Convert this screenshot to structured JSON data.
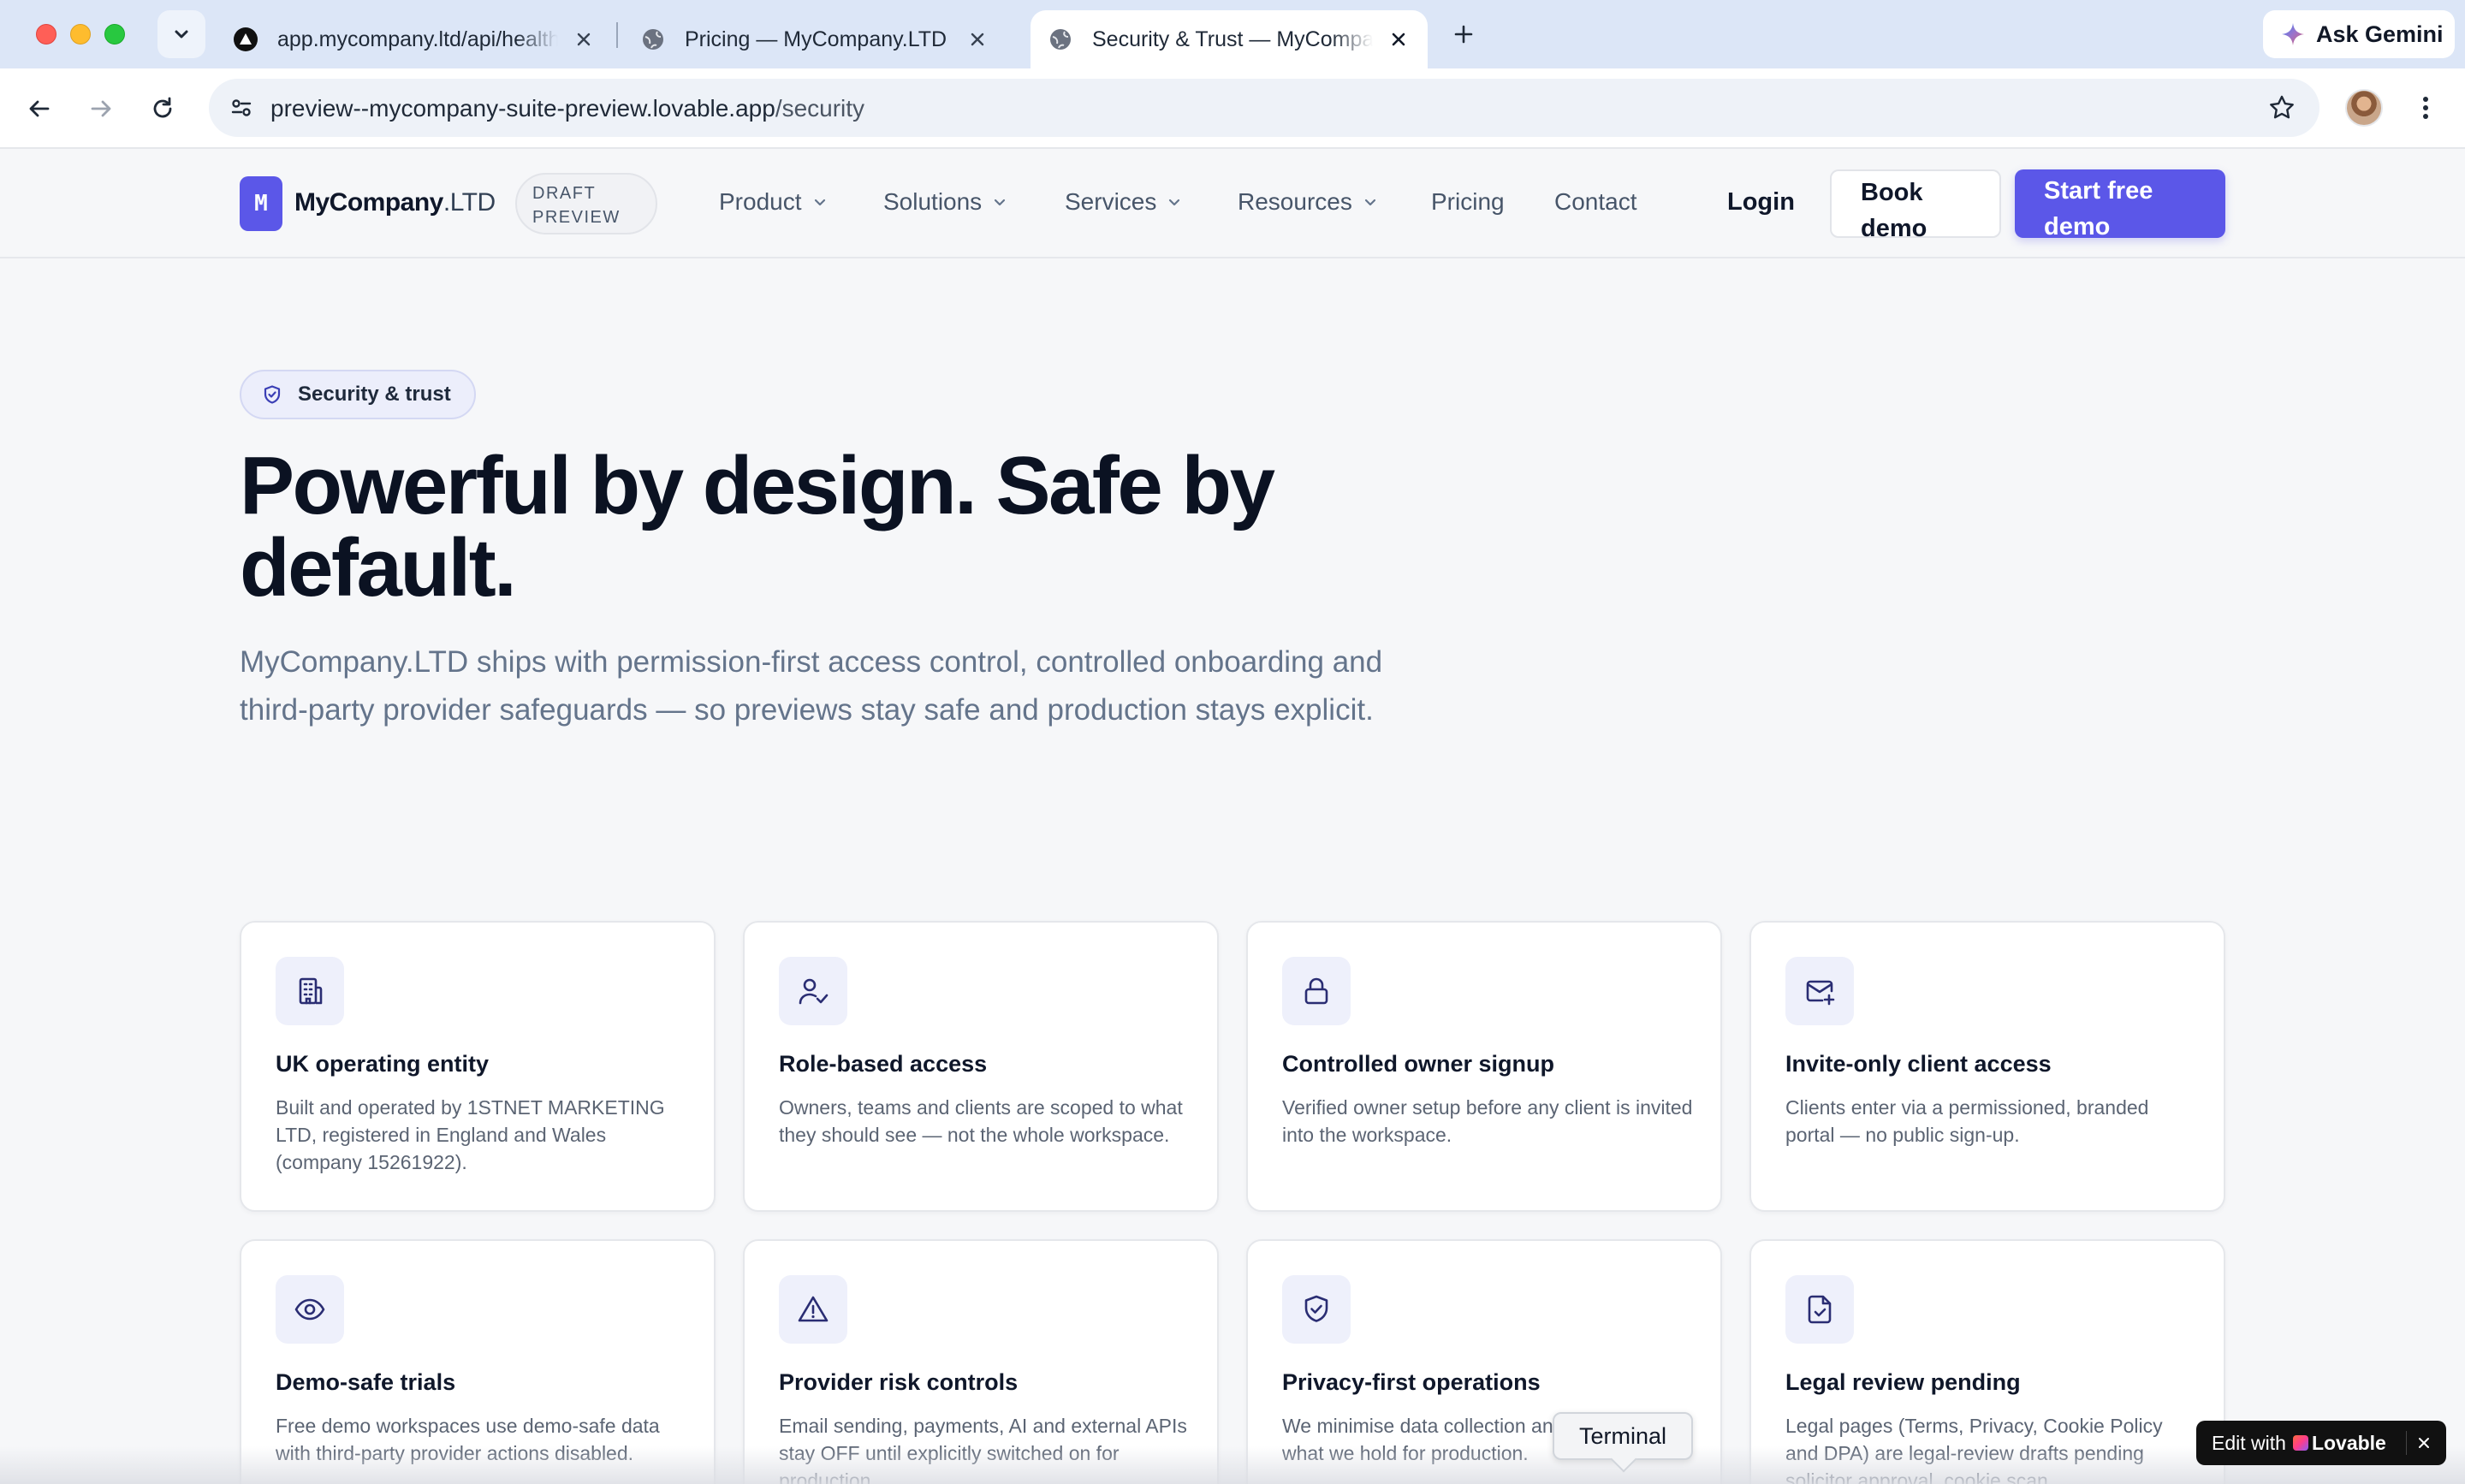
{
  "browser": {
    "tabs": [
      {
        "title": "app.mycompany.ltd/api/health",
        "favicon": "triangle-logo-icon"
      },
      {
        "title": "Pricing — MyCompany.LTD",
        "favicon": "globe-icon"
      },
      {
        "title": "Security & Trust — MyCompany.LTD",
        "favicon": "globe-icon",
        "active": true
      }
    ],
    "ask_gemini": "Ask Gemini",
    "url_host": "preview--mycompany-suite-preview.lovable.app",
    "url_path": "/security"
  },
  "header": {
    "logo_mark": "M",
    "logo_name": "MyCompany",
    "logo_suffix": ".LTD",
    "draft_line1": "DRAFT",
    "draft_line2": "PREVIEW",
    "nav": [
      {
        "label": "Product",
        "dropdown": true
      },
      {
        "label": "Solutions",
        "dropdown": true
      },
      {
        "label": "Services",
        "dropdown": true
      },
      {
        "label": "Resources",
        "dropdown": true
      },
      {
        "label": "Pricing",
        "dropdown": false
      },
      {
        "label": "Contact",
        "dropdown": false
      }
    ],
    "login": "Login",
    "book_demo_line1": "Book",
    "book_demo_line2": "demo",
    "start_demo_line1": "Start free",
    "start_demo_line2": "demo"
  },
  "hero": {
    "badge": "Security & trust",
    "title_line1": "Powerful by design. Safe by",
    "title_line2": "default.",
    "subtitle": "MyCompany.LTD ships with permission-first access control, controlled onboarding and third-party provider safeguards — so previews stay safe and production stays explicit."
  },
  "features": [
    {
      "icon": "building-icon",
      "title": "UK operating entity",
      "desc": "Built and operated by 1STNET MARKETING LTD, registered in England and Wales (company 15261922)."
    },
    {
      "icon": "user-check-icon",
      "title": "Role-based access",
      "desc": "Owners, teams and clients are scoped to what they should see — not the whole workspace."
    },
    {
      "icon": "lock-icon",
      "title": "Controlled owner signup",
      "desc": "Verified owner setup before any client is invited into the workspace."
    },
    {
      "icon": "mail-plus-icon",
      "title": "Invite-only client access",
      "desc": "Clients enter via a permissioned, branded portal — no public sign-up."
    },
    {
      "icon": "eye-icon",
      "title": "Demo-safe trials",
      "desc": "Free demo workspaces use demo-safe data with third-party provider actions disabled."
    },
    {
      "icon": "alert-triangle-icon",
      "title": "Provider risk controls",
      "desc": "Email sending, payments, AI and external APIs stay OFF until explicitly switched on for production."
    },
    {
      "icon": "shield-check-icon",
      "title": "Privacy-first operations",
      "desc": "We minimise data collection and document what we hold for production."
    },
    {
      "icon": "file-check-icon",
      "title": "Legal review pending",
      "desc": "Legal pages (Terms, Privacy, Cookie Policy and DPA) are legal-review drafts pending solicitor approval, cookie scan"
    }
  ],
  "overlays": {
    "tooltip": "Terminal",
    "lovable_prefix": "Edit with",
    "lovable_brand": "Lovable"
  },
  "colors": {
    "accent": "#5b57e8",
    "text": "#0f172a",
    "muted": "#64748b",
    "page_bg": "#f6f7f9",
    "icon_bg": "#eef0fb"
  }
}
